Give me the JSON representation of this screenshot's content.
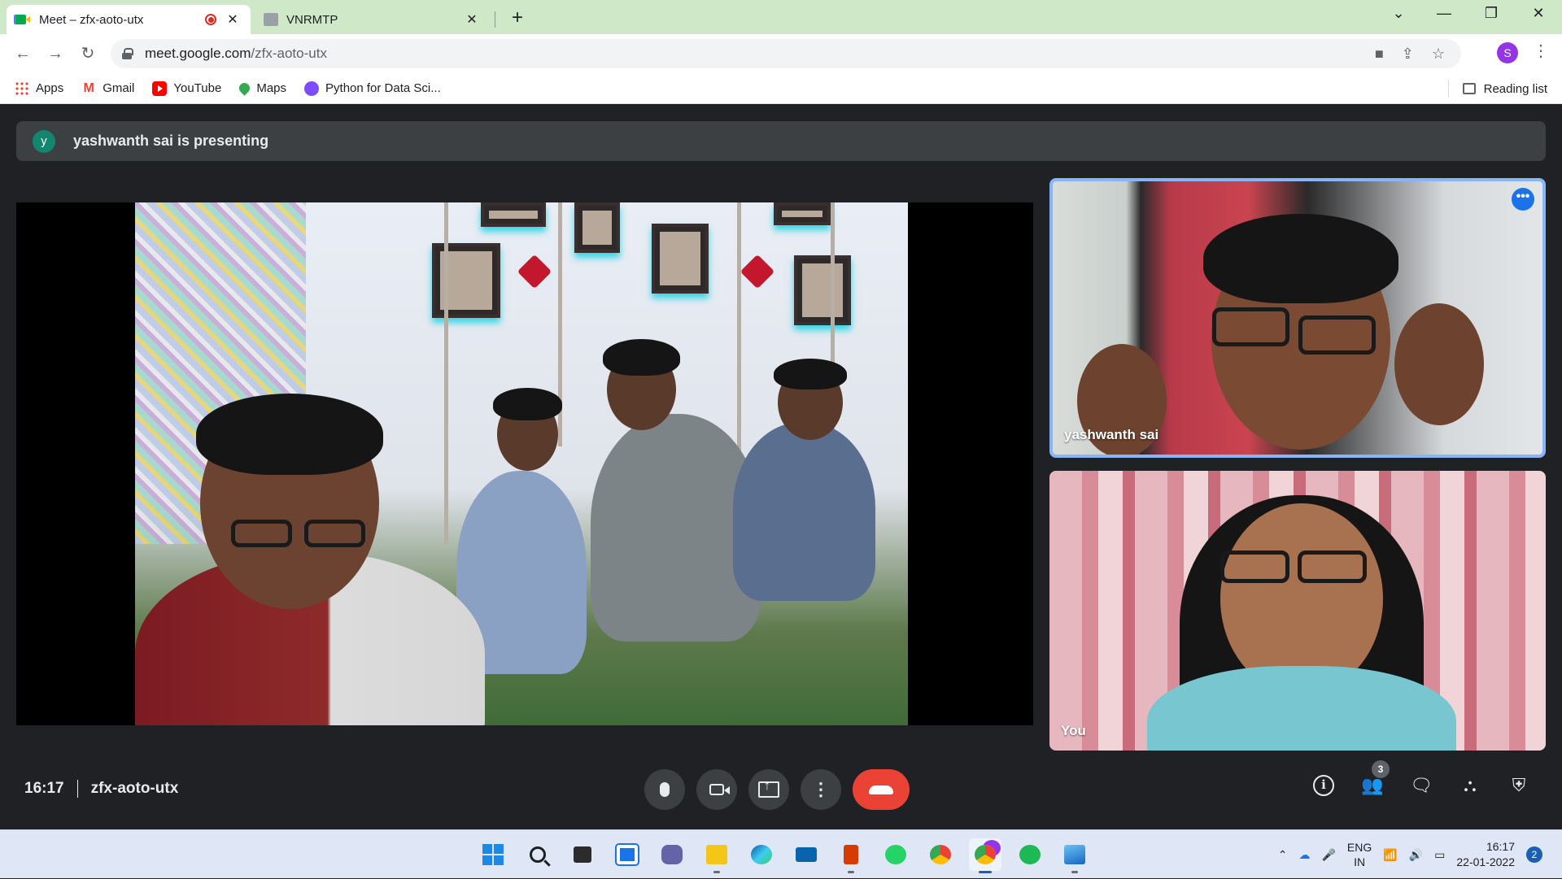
{
  "browser": {
    "tabs": [
      {
        "title": "Meet – zfx-aoto-utx",
        "active": true,
        "recording": true,
        "icon": "google-meet-icon"
      },
      {
        "title": "VNRMTP",
        "active": false,
        "icon": "site-favicon"
      }
    ],
    "new_tab_symbol": "+",
    "window_controls": {
      "dropdown": "⌄",
      "minimize": "—",
      "maximize": "❐",
      "close": "✕"
    },
    "url_host": "meet.google.com",
    "url_path": "/zfx-aoto-utx",
    "profile_initial": "S",
    "colors": {
      "tabstrip": "#cfe8c8",
      "profile": "#9334e6"
    }
  },
  "bookmarks": [
    {
      "label": "Apps",
      "icon": "apps-grid-icon"
    },
    {
      "label": "Gmail",
      "icon": "gmail-icon"
    },
    {
      "label": "YouTube",
      "icon": "youtube-icon"
    },
    {
      "label": "Maps",
      "icon": "maps-pin-icon"
    },
    {
      "label": "Python for Data Sci...",
      "icon": "course-icon"
    }
  ],
  "reading_list": "Reading list",
  "meet": {
    "presenting_banner": {
      "avatar_initial": "y",
      "text": "yashwanth sai is presenting"
    },
    "participants": [
      {
        "name": "yashwanth sai",
        "speaking_highlight": true
      },
      {
        "name": "You"
      }
    ],
    "participant_count": "3",
    "time": "16:17",
    "meeting_code": "zfx-aoto-utx",
    "colors": {
      "hangup": "#ea4335",
      "active_border": "#8ab4f8",
      "banner_avatar": "#12866e"
    }
  },
  "taskbar": {
    "lang_top": "ENG",
    "lang_bottom": "IN",
    "time": "16:17",
    "date": "22-01-2022",
    "notifications": "2"
  }
}
